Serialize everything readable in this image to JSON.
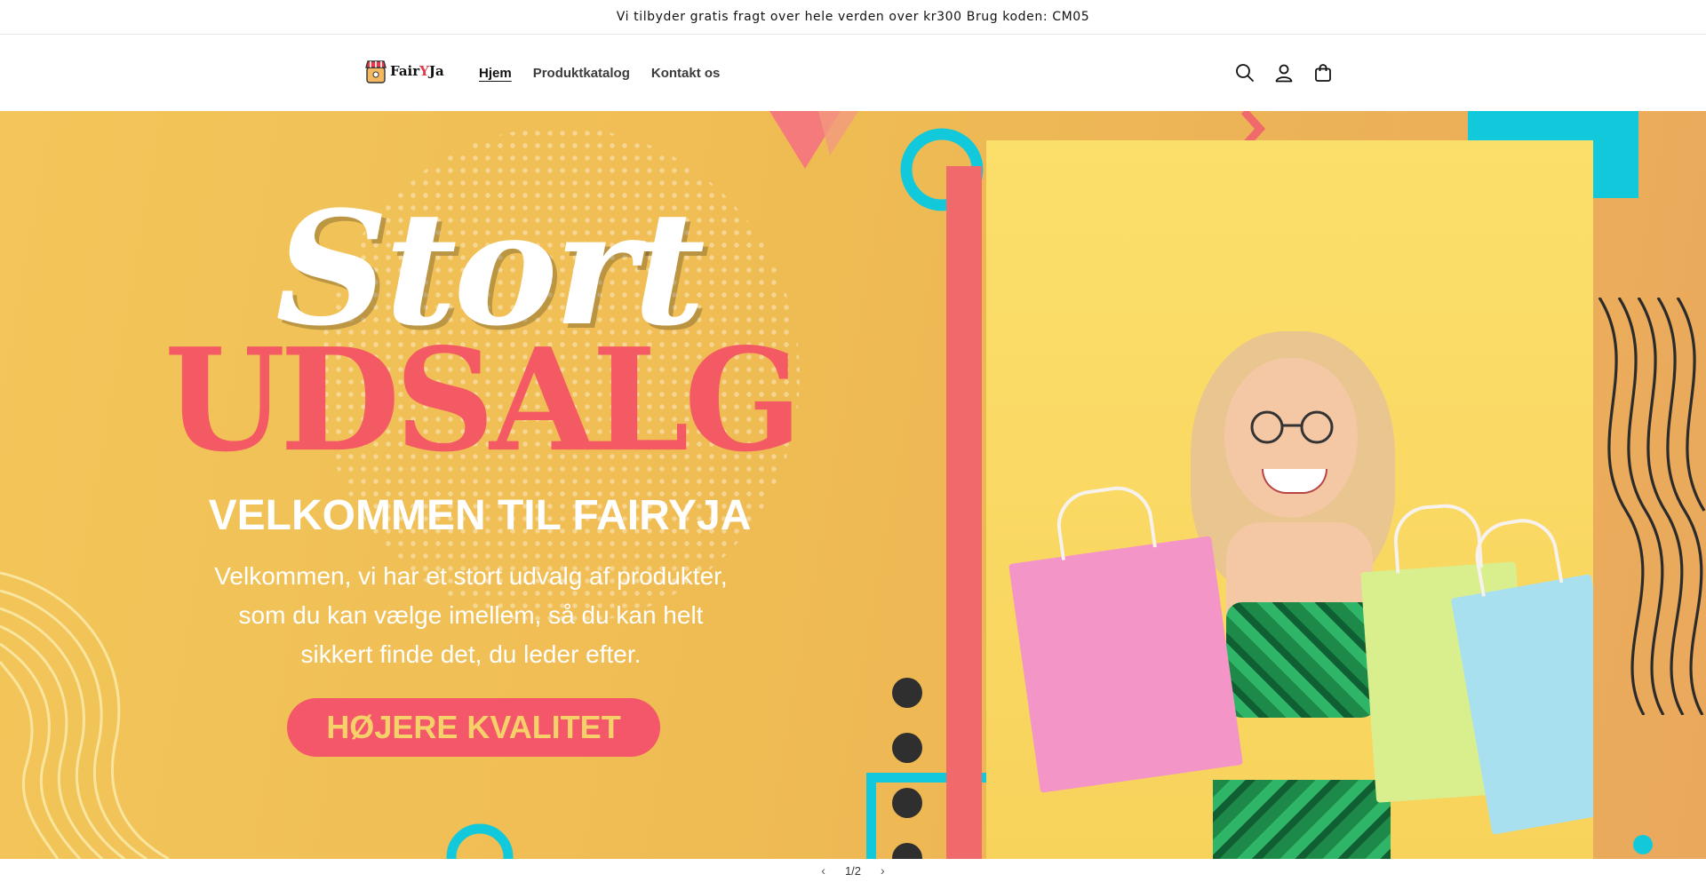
{
  "announcement": {
    "text": "Vi tilbyder gratis fragt over hele verden over kr300  Brug koden: CM05"
  },
  "header": {
    "logo_text_a": "Fair",
    "logo_text_y": "Y",
    "logo_text_b": "Ja",
    "nav": [
      {
        "label": "Hjem"
      },
      {
        "label": "Produktkatalog"
      },
      {
        "label": "Kontakt os"
      }
    ],
    "icons": [
      "search-icon",
      "account-icon",
      "cart-icon"
    ]
  },
  "hero": {
    "script_word": "Stort",
    "headline": "UDSALG",
    "welcome": "VELKOMMEN TIL FAIRYJA",
    "description_lines": [
      "Velkommen, vi har et stort udvalg af produkter,",
      "som du kan vælge imellem, så du kan helt",
      "sikkert finde det, du leder efter."
    ],
    "cta_label": "HØJERE KVALITET"
  },
  "slideshow": {
    "counter": "1/2"
  },
  "colors": {
    "accent_red": "#f45a63",
    "hero_yellow": "#efbc53",
    "cta_text": "#f6d16a",
    "cyan": "#12c9dc"
  }
}
